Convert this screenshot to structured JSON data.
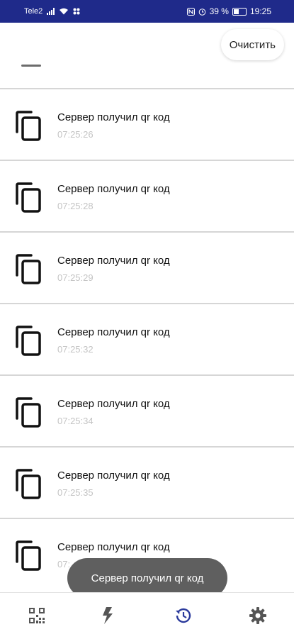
{
  "status_bar": {
    "carrier": "Tele2",
    "battery": "39 %",
    "time": "19:25"
  },
  "toolbar": {
    "clear_label": "Очистить"
  },
  "history": [
    {
      "title": "Сервер получил qr код",
      "time": "07:25:26"
    },
    {
      "title": "Сервер получил qr код",
      "time": "07:25:28"
    },
    {
      "title": "Сервер получил qr код",
      "time": "07:25:29"
    },
    {
      "title": "Сервер получил qr код",
      "time": "07:25:32"
    },
    {
      "title": "Сервер получил qr код",
      "time": "07:25:34"
    },
    {
      "title": "Сервер получил qr код",
      "time": "07:25:35"
    },
    {
      "title": "Сервер получил qr код",
      "time": "07:"
    }
  ],
  "toast": {
    "text": "Сервер получил qr код"
  },
  "bottom_nav": [
    {
      "icon": "qr-code-icon",
      "active": false
    },
    {
      "icon": "lightning-icon",
      "active": false
    },
    {
      "icon": "history-icon",
      "active": true
    },
    {
      "icon": "gear-icon",
      "active": false
    }
  ],
  "colors": {
    "status_bar": "#1f2a8a",
    "nav_active": "#2b3a9c",
    "nav_inactive": "#555555",
    "timestamp": "#c4c4c4"
  }
}
